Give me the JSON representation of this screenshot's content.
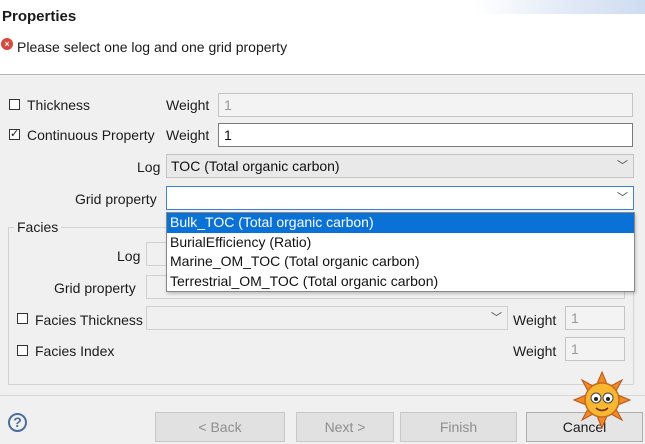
{
  "dialog": {
    "title": "Properties",
    "error_message": "Please select one log and one grid property"
  },
  "form": {
    "thickness": {
      "label": "Thickness",
      "checked": false,
      "weight_label": "Weight",
      "weight_value": "1"
    },
    "continuous": {
      "label": "Continuous Property",
      "checked": true,
      "weight_label": "Weight",
      "weight_value": "1"
    },
    "log": {
      "label": "Log",
      "value": "TOC (Total organic carbon)"
    },
    "grid_property": {
      "label": "Grid property",
      "value": ""
    },
    "grid_property_options": [
      "Bulk_TOC (Total organic carbon)",
      "BurialEfficiency (Ratio)",
      "Marine_OM_TOC (Total organic carbon)",
      "Terrestrial_OM_TOC (Total organic carbon)"
    ],
    "selected_option_index": 0
  },
  "facies": {
    "group_label": "Facies",
    "log_label": "Log",
    "grid_property_label": "Grid property",
    "thickness": {
      "label": "Facies Thickness",
      "checked": false,
      "weight_label": "Weight",
      "weight_value": "1"
    },
    "index": {
      "label": "Facies Index",
      "checked": false,
      "weight_label": "Weight",
      "weight_value": "1"
    }
  },
  "footer": {
    "help_glyph": "?",
    "back_label": "< Back",
    "next_label": "Next >",
    "finish_label": "Finish",
    "cancel_label": "Cancel"
  },
  "icons": {
    "error": "error-icon",
    "help": "help-icon",
    "chevron": "chevron-down-icon"
  },
  "colors": {
    "selection": "#0a72d6",
    "error": "#d9473e",
    "focus_border": "#3c7fd4"
  }
}
